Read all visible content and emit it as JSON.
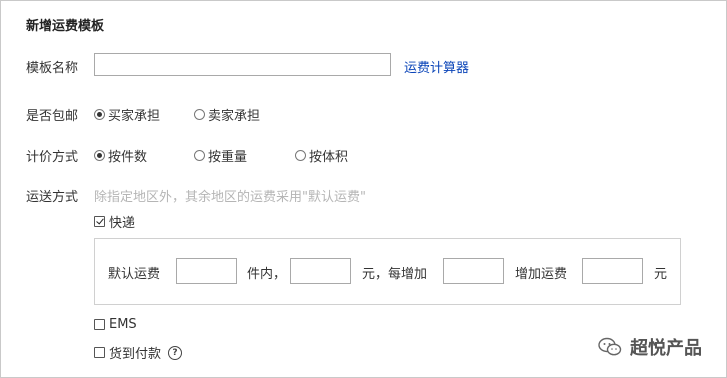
{
  "form": {
    "title": "新增运费模板",
    "template_name": {
      "label": "模板名称",
      "value": "",
      "link": "运费计算器"
    },
    "shipping_paid": {
      "label": "是否包邮",
      "options": [
        "买家承担",
        "卖家承担"
      ],
      "selected": "买家承担"
    },
    "pricing_method": {
      "label": "计价方式",
      "options": [
        "按件数",
        "按重量",
        "按体积"
      ],
      "selected": "按件数"
    },
    "delivery_method": {
      "label": "运送方式",
      "hint": "除指定地区外，其余地区的运费采用\"默认运费\"",
      "express": {
        "label": "快递",
        "checked": true
      },
      "fees": {
        "default_fee_label": "默认运费",
        "pieces_unit": "件内，",
        "yuan_each_add": "元，每增加",
        "add_fee_label": "增加运费",
        "yuan": "元"
      },
      "ems": {
        "label": "EMS",
        "checked": false
      },
      "cod": {
        "label": "货到付款",
        "checked": false,
        "help": "?"
      }
    }
  },
  "watermark": {
    "text": "超悦产品"
  },
  "icons": {
    "help": "question-circle-icon",
    "watermark": "wechat-logo-icon"
  }
}
